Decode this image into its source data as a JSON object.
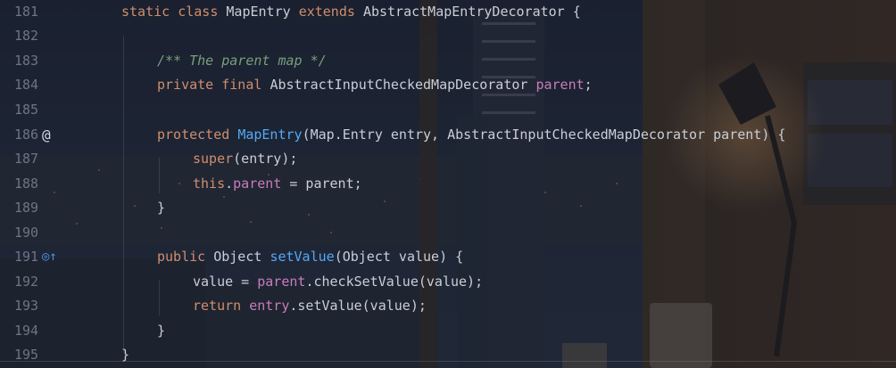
{
  "editor": {
    "line_numbers": [
      "181",
      "182",
      "183",
      "184",
      "185",
      "186",
      "187",
      "188",
      "189",
      "190",
      "191",
      "192",
      "193",
      "194",
      "195"
    ],
    "gutter_icons": {
      "override_marker": "@",
      "implements_marker": "◎↑"
    },
    "lines": {
      "l181": {
        "k1": "static",
        "k2": "class",
        "name": "MapEntry",
        "k3": "extends",
        "base": "AbstractMapEntryDecorator",
        "brace": "{"
      },
      "l183": {
        "comment": "/** The parent map */"
      },
      "l184": {
        "k1": "private",
        "k2": "final",
        "type": "AbstractInputCheckedMapDecorator",
        "field": "parent",
        "end": ";"
      },
      "l186": {
        "k1": "protected",
        "name": "MapEntry",
        "params_a": "(Map.Entry entry, AbstractInputCheckedMapDecorator parent) {"
      },
      "l187": {
        "k1": "super",
        "rest": "(entry);"
      },
      "l188": {
        "k1": "this",
        "dot": ".",
        "field": "parent",
        "rest": " = parent;"
      },
      "l189": {
        "brace": "}"
      },
      "l191": {
        "k1": "public",
        "type": "Object",
        "name": "setValue",
        "rest": "(Object value) {"
      },
      "l192": {
        "a": "value = ",
        "field": "parent",
        "rest": ".checkSetValue(value);"
      },
      "l193": {
        "k1": "return",
        "field": "entry",
        "rest": ".setValue(value);"
      },
      "l194": {
        "brace": "}"
      },
      "l195": {
        "brace": "}"
      }
    }
  },
  "colors": {
    "keyword": "#cf8e6d",
    "function": "#56a8f5",
    "field": "#c77dbb",
    "comment": "#7a9e7e",
    "text": "#c9ced8",
    "line_number": "#6d7482"
  },
  "icons": {
    "override": "at-sign-icon",
    "implements": "implementing-method-icon"
  }
}
